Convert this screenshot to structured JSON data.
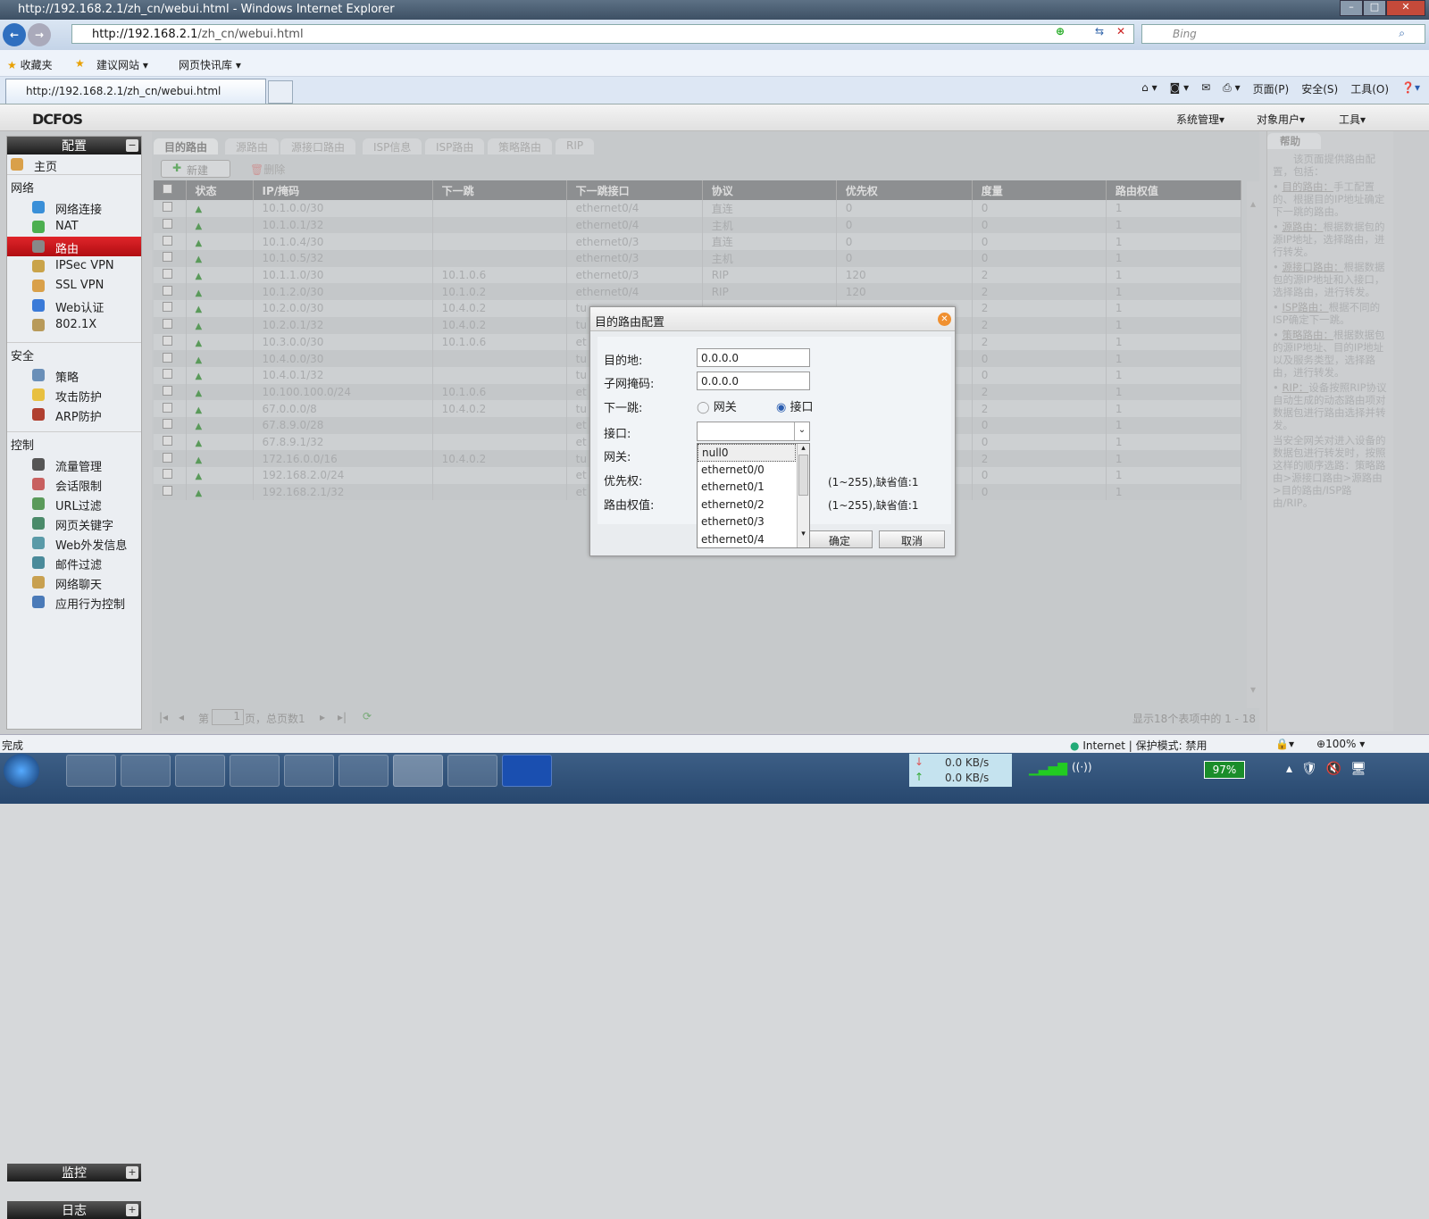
{
  "browser": {
    "title": "http://192.168.2.1/zh_cn/webui.html - Windows Internet Explorer",
    "url_host": "http://192.168.2.1",
    "url_path": "/zh_cn/webui.html",
    "search_placeholder": "Bing",
    "favorites": "收藏夹",
    "suggested": "建议网站",
    "webslice": "网页快讯库",
    "tab_title": "http://192.168.2.1/zh_cn/webui.html",
    "cmd": [
      "页面(P)",
      "安全(S)",
      "工具(O)"
    ]
  },
  "app": {
    "logo": "DCFOS",
    "menus": [
      "系统管理",
      "对象用户",
      "工具"
    ]
  },
  "sidebar": {
    "config": "配置",
    "home": "主页",
    "network_group": "网络",
    "network": [
      "网络连接",
      "NAT",
      "路由",
      "IPSec VPN",
      "SSL VPN",
      "Web认证",
      "802.1X"
    ],
    "security_group": "安全",
    "security": [
      "策略",
      "攻击防护",
      "ARP防护"
    ],
    "control_group": "控制",
    "control": [
      "流量管理",
      "会话限制",
      "URL过滤",
      "网页关键字",
      "Web外发信息",
      "邮件过滤",
      "网络聊天",
      "应用行为控制"
    ],
    "monitor": "监控",
    "log": "日志"
  },
  "main": {
    "tabs": [
      "目的路由",
      "源路由",
      "源接口路由",
      "ISP信息",
      "ISP路由",
      "策略路由",
      "RIP"
    ],
    "new": "新建",
    "delete": "删除",
    "columns": [
      "状态",
      "IP/掩码",
      "下一跳",
      "下一跳接口",
      "协议",
      "优先权",
      "度量",
      "路由权值"
    ],
    "rows": [
      [
        "10.1.0.0/30",
        "",
        "ethernet0/4",
        "直连",
        "0",
        "0",
        "1"
      ],
      [
        "10.1.0.1/32",
        "",
        "ethernet0/4",
        "主机",
        "0",
        "0",
        "1"
      ],
      [
        "10.1.0.4/30",
        "",
        "ethernet0/3",
        "直连",
        "0",
        "0",
        "1"
      ],
      [
        "10.1.0.5/32",
        "",
        "ethernet0/3",
        "主机",
        "0",
        "0",
        "1"
      ],
      [
        "10.1.1.0/30",
        "10.1.0.6",
        "ethernet0/3",
        "RIP",
        "120",
        "2",
        "1"
      ],
      [
        "10.1.2.0/30",
        "10.1.0.2",
        "ethernet0/4",
        "RIP",
        "120",
        "2",
        "1"
      ],
      [
        "10.2.0.0/30",
        "10.4.0.2",
        "tu",
        "",
        "",
        "2",
        "1"
      ],
      [
        "10.2.0.1/32",
        "10.4.0.2",
        "tu",
        "",
        "",
        "2",
        "1"
      ],
      [
        "10.3.0.0/30",
        "10.1.0.6",
        "et",
        "",
        "",
        "2",
        "1"
      ],
      [
        "10.4.0.0/30",
        "",
        "tu",
        "",
        "",
        "0",
        "1"
      ],
      [
        "10.4.0.1/32",
        "",
        "tu",
        "",
        "",
        "0",
        "1"
      ],
      [
        "10.100.100.0/24",
        "10.1.0.6",
        "et",
        "",
        "",
        "2",
        "1"
      ],
      [
        "67.0.0.0/8",
        "10.4.0.2",
        "tu",
        "",
        "",
        "2",
        "1"
      ],
      [
        "67.8.9.0/28",
        "",
        "et",
        "",
        "",
        "0",
        "1"
      ],
      [
        "67.8.9.1/32",
        "",
        "et",
        "",
        "",
        "0",
        "1"
      ],
      [
        "172.16.0.0/16",
        "10.4.0.2",
        "tu",
        "",
        "",
        "2",
        "1"
      ],
      [
        "192.168.2.0/24",
        "",
        "et",
        "",
        "",
        "0",
        "1"
      ],
      [
        "192.168.2.1/32",
        "",
        "et",
        "",
        "",
        "0",
        "1"
      ]
    ],
    "pager": {
      "page_prefix": "第",
      "page": "1",
      "page_suffix": "页，总页数1",
      "summary": "显示18个表项中的 1 - 18"
    }
  },
  "help": {
    "tab": "帮助",
    "intro": "该页面提供路由配置，包括：",
    "items": [
      {
        "t": "目的路由：",
        "d": "手工配置的、根据目的IP地址确定下一跳的路由。"
      },
      {
        "t": "源路由：",
        "d": "根据数据包的源IP地址，选择路由，进行转发。"
      },
      {
        "t": "源接口路由：",
        "d": "根据数据包的源IP地址和入接口，选择路由，进行转发。"
      },
      {
        "t": "ISP路由：",
        "d": "根据不同的ISP确定下一跳。"
      },
      {
        "t": "策略路由：",
        "d": "根据数据包的源IP地址、目的IP地址以及服务类型，选择路由，进行转发。"
      },
      {
        "t": "RIP：",
        "d": "设备按照RIP协议自动生成的动态路由项对数据包进行路由选择并转发。"
      }
    ],
    "footer": "当安全网关对进入设备的数据包进行转发时，按照这样的顺序选路：策略路由>源接口路由>源路由>目的路由/ISP路由/RIP。"
  },
  "dialog": {
    "title": "目的路由配置",
    "dest_label": "目的地:",
    "dest": "0.0.0.0",
    "mask_label": "子网掩码:",
    "mask": "0.0.0.0",
    "nexthop_label": "下一跳:",
    "opt_gateway": "网关",
    "opt_iface": "接口",
    "iface_label": "接口:",
    "gateway_label": "网关:",
    "prio_label": "优先权:",
    "prio_hint": "(1~255),缺省值:1",
    "weight_label": "路由权值:",
    "weight_hint": "(1~255),缺省值:1",
    "ok": "确定",
    "cancel": "取消",
    "options": [
      "null0",
      "ethernet0/0",
      "ethernet0/1",
      "ethernet0/2",
      "ethernet0/3",
      "ethernet0/4"
    ]
  },
  "status": {
    "done": "完成",
    "zone": "Internet | 保护模式: 禁用",
    "zoom": "100%"
  },
  "taskbar": {
    "down": "0.0 KB/s",
    "up": "0.0 KB/s",
    "battery": "97%"
  }
}
